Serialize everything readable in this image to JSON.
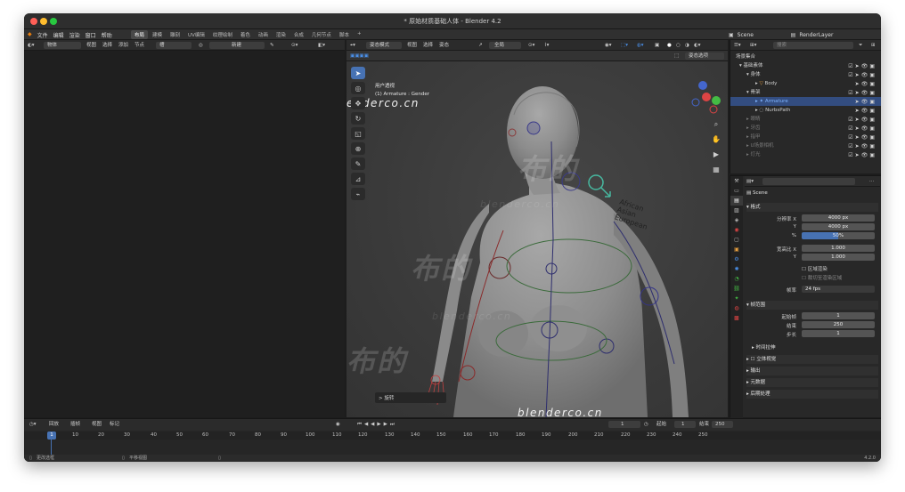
{
  "window": {
    "title": "* 原始材质基础人体 - Blender 4.2",
    "close_color": "#ff5f57",
    "minimize_color": "#febc2e",
    "zoom_color": "#28c840"
  },
  "menu": [
    "文件",
    "编辑",
    "渲染",
    "窗口",
    "帮助"
  ],
  "workspaces": [
    "布局",
    "建模",
    "雕刻",
    "UV编辑",
    "纹理绘制",
    "着色",
    "动画",
    "渲染",
    "合成",
    "几何节点",
    "脚本"
  ],
  "topbar": {
    "scene": "Scene",
    "view_layer": "RenderLayer"
  },
  "left_header": {
    "mode": "物体",
    "view": "视图",
    "select": "选择",
    "add": "添加",
    "node": "节点",
    "slot": "槽",
    "new_button": "新建"
  },
  "viewport_header": {
    "mode": "姿态模式",
    "view": "视图",
    "select": "选择",
    "pose": "姿态",
    "transform": "全局",
    "options": "选项",
    "xray": "姿态选项"
  },
  "viewport": {
    "info_line1": "用户透视",
    "info_line2": "(1) Armature : Gender",
    "op_panel": "> 旋转",
    "gender_labels": [
      "African",
      "Asian",
      "European"
    ],
    "accent": "#4772b3"
  },
  "watermarks": {
    "site": "blenderco.cn",
    "brand": "布的"
  },
  "outliner": {
    "search_placeholder": "搜索",
    "rows": [
      {
        "label": "场景集合",
        "state": "normal"
      },
      {
        "label": "基础素体",
        "state": "normal"
      },
      {
        "label": "身体",
        "state": "normal"
      },
      {
        "label": "Body",
        "state": "normal"
      },
      {
        "label": "骨架",
        "state": "normal"
      },
      {
        "label": "Armature",
        "state": "selected"
      },
      {
        "label": "NurbsPath",
        "state": "normal"
      },
      {
        "label": "眼睛",
        "state": "dim"
      },
      {
        "label": "牙齿",
        "state": "dim"
      },
      {
        "label": "指甲",
        "state": "dim"
      },
      {
        "label": "U场景相机",
        "state": "dim"
      },
      {
        "label": "灯光",
        "state": "dim"
      }
    ]
  },
  "properties": {
    "scene_name": "Scene",
    "format_section": "格式",
    "res_x_label": "分辨率 X",
    "res_x": "4000 px",
    "res_y_label": "Y",
    "res_y": "4000 px",
    "percent_label": "%",
    "percent": "50%",
    "aspect_x_label": "宽高比 X",
    "aspect_x": "1.000",
    "aspect_y_label": "Y",
    "aspect_y": "1.000",
    "render_region": "区域渲染",
    "crop_region": "裁切至渲染区域",
    "fps_label": "帧率",
    "fps": "24 fps",
    "frame_range_section": "帧范围",
    "start_label": "起始帧",
    "start": "1",
    "end_label": "结束",
    "end": "250",
    "step_label": "步长",
    "step": "1",
    "time_stretch": "时间拉伸",
    "stereoscopy": "立体视觉",
    "output": "输出",
    "metadata": "元数据",
    "post_processing": "后期处理"
  },
  "timeline": {
    "playback": "回放",
    "keying": "插帧",
    "view": "视图",
    "marker": "标记",
    "current_frame": "1",
    "start_label": "起始",
    "start": "1",
    "end_label": "结束",
    "end": "250",
    "ticks": [
      "1",
      "10",
      "20",
      "30",
      "40",
      "50",
      "60",
      "70",
      "80",
      "90",
      "100",
      "110",
      "120",
      "130",
      "140",
      "150",
      "160",
      "170",
      "180",
      "190",
      "200",
      "210",
      "220",
      "230",
      "240",
      "250"
    ]
  },
  "statusbar": {
    "left": "更改选框",
    "middle": "平移视图",
    "version": "4.2.0"
  }
}
